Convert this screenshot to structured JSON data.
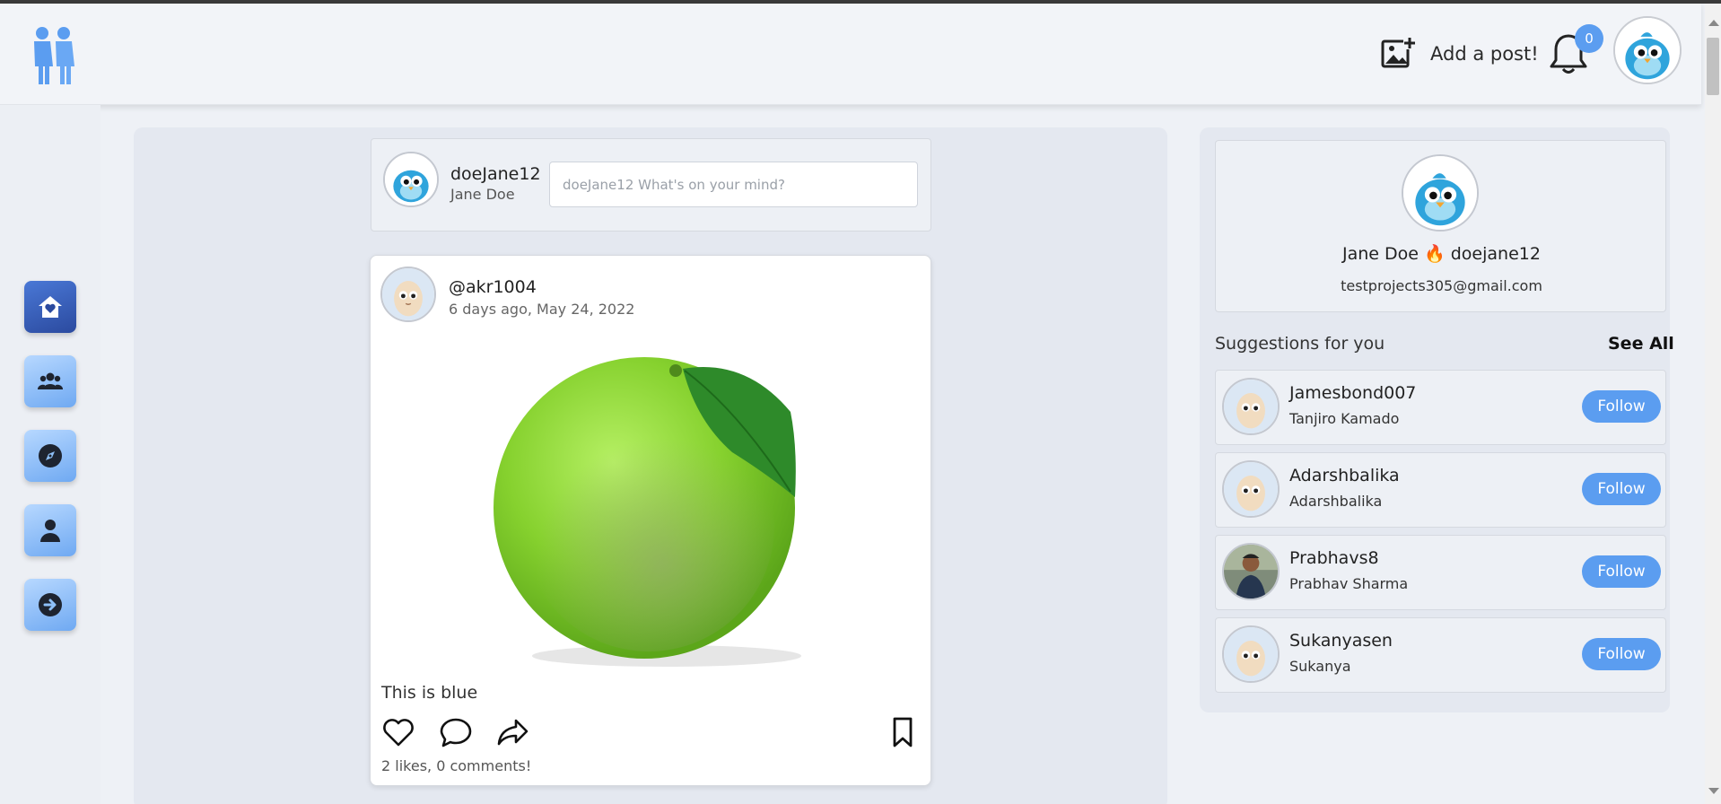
{
  "header": {
    "add_post_label": "Add a post!",
    "notification_count": "0"
  },
  "nav": {
    "items": [
      {
        "icon": "home-icon",
        "active": true
      },
      {
        "icon": "users-icon",
        "active": false
      },
      {
        "icon": "compass-icon",
        "active": false
      },
      {
        "icon": "user-icon",
        "active": false
      },
      {
        "icon": "logout-icon",
        "active": false
      }
    ]
  },
  "composer": {
    "username": "doeJane12",
    "fullname": "Jane Doe",
    "placeholder": "doeJane12 What's on your mind?"
  },
  "post": {
    "username": "@akr1004",
    "time": "6 days ago, May 24, 2022",
    "caption": "This is blue",
    "stats": "2 likes, 0 comments!"
  },
  "profile": {
    "name": "Jane Doe",
    "emoji": "🔥",
    "username": "doejane12",
    "email": "testprojects305@gmail.com"
  },
  "suggestions": {
    "title": "Suggestions for you",
    "see_all": "See All",
    "items": [
      {
        "username": "Jamesbond007",
        "fullname": "Tanjiro Kamado",
        "button": "Follow"
      },
      {
        "username": "Adarshbalika",
        "fullname": "Adarshbalika",
        "button": "Follow"
      },
      {
        "username": "Prabhavs8",
        "fullname": "Prabhav Sharma",
        "button": "Follow"
      },
      {
        "username": "Sukanyasen",
        "fullname": "Sukanya",
        "button": "Follow"
      }
    ]
  },
  "colors": {
    "accent": "#5b9df0",
    "nav_active": "#2b4a9f",
    "background": "#eef1f6"
  }
}
